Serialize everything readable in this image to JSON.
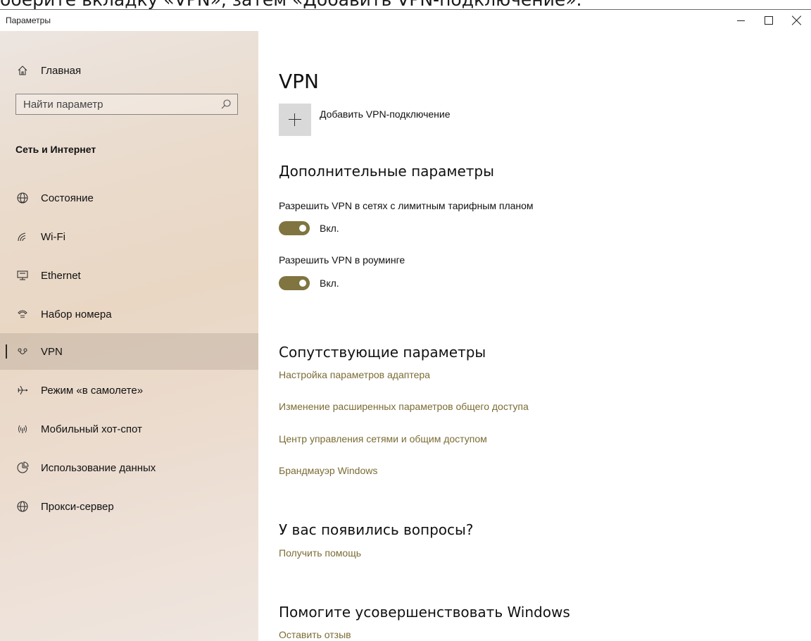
{
  "caption": {
    "text": "оберите вкладку «VPN», затем «Добавить VPN-подключение»."
  },
  "window": {
    "title": "Параметры"
  },
  "sidebar": {
    "home_label": "Главная",
    "search_placeholder": "Найти параметр",
    "section_title": "Сеть и Интернет",
    "items": [
      {
        "label": "Состояние",
        "icon": "status-globe-icon"
      },
      {
        "label": "Wi-Fi",
        "icon": "wifi-icon"
      },
      {
        "label": "Ethernet",
        "icon": "ethernet-icon"
      },
      {
        "label": "Набор номера",
        "icon": "dialup-icon"
      },
      {
        "label": "VPN",
        "icon": "vpn-icon",
        "selected": true
      },
      {
        "label": "Режим «в самолете»",
        "icon": "airplane-icon"
      },
      {
        "label": "Мобильный хот-спот",
        "icon": "hotspot-icon"
      },
      {
        "label": "Использование данных",
        "icon": "data-usage-icon"
      },
      {
        "label": "Прокси-сервер",
        "icon": "proxy-globe-icon"
      }
    ]
  },
  "main": {
    "title": "VPN",
    "add_vpn_label": "Добавить VPN-подключение",
    "advanced_heading": "Дополнительные параметры",
    "settings": [
      {
        "label": "Разрешить VPN в сетях с лимитным тарифным планом",
        "state": "Вкл.",
        "on": true
      },
      {
        "label": "Разрешить VPN в роуминге",
        "state": "Вкл.",
        "on": true
      }
    ],
    "related_heading": "Сопутствующие параметры",
    "related_links": [
      "Настройка параметров адаптера",
      "Изменение расширенных параметров общего доступа",
      "Центр управления сетями и общим доступом",
      "Брандмауэр Windows"
    ],
    "questions_heading": "У вас появились вопросы?",
    "help_link": "Получить помощь",
    "improve_heading": "Помогите усовершенствовать Windows",
    "feedback_link": "Оставить отзыв"
  },
  "colors": {
    "accent": "#807440",
    "link": "#7a6c34",
    "sidebar_bg": "#e9d7c4"
  }
}
